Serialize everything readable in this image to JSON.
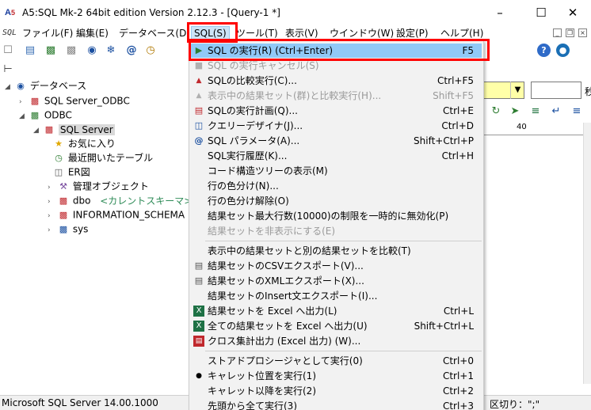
{
  "window": {
    "title": "A5:SQL Mk-2 64bit edition Version 2.12.3 - [Query-1 *]",
    "icon_text": "A5"
  },
  "menubar": {
    "sql_mark": "SQL",
    "items": [
      "ファイル(F)",
      "編集(E)",
      "データベース(D",
      "SQL(S)",
      "ツール(T)",
      "表示(V)",
      "ウインドウ(W)",
      "設定(P)",
      "ヘルプ(H)"
    ]
  },
  "tree": {
    "root": "データベース",
    "nodes": [
      {
        "label": "SQL Server_ODBC"
      },
      {
        "label": "ODBC"
      },
      {
        "label": "SQL Server"
      },
      {
        "label": "お気に入り"
      },
      {
        "label": "最近開いたテーブル"
      },
      {
        "label": "ER図"
      },
      {
        "label": "管理オブジェクト"
      },
      {
        "label": "dbo",
        "extra": "<カレントスキーマ>"
      },
      {
        "label": "INFORMATION_SCHEMA"
      },
      {
        "label": "sys"
      }
    ]
  },
  "dropdown": {
    "items": [
      {
        "label": "SQL の実行(R)  (Ctrl+Enter)",
        "shortcut": "F5",
        "icon": "play-icon"
      },
      {
        "label": "SQL の実行キャンセル(S)",
        "shortcut": "",
        "icon": "cancel-icon"
      },
      {
        "label": "SQLの比較実行(C)...",
        "shortcut": "Ctrl+F5",
        "icon": "compare-icon"
      },
      {
        "label": "表示中の結果セット(群)と比較実行(H)...",
        "shortcut": "Shift+F5",
        "icon": "compare-result-icon"
      },
      {
        "label": "SQLの実行計画(Q)...",
        "shortcut": "Ctrl+E",
        "icon": "plan-icon"
      },
      {
        "label": "クエリーデザイナ(J)...",
        "shortcut": "Ctrl+D",
        "icon": "designer-icon"
      },
      {
        "label": "SQL パラメータ(A)...",
        "shortcut": "Shift+Ctrl+P",
        "icon": "at-icon"
      },
      {
        "label": "SQL実行履歴(K)...",
        "shortcut": "Ctrl+H",
        "icon": ""
      },
      {
        "label": "コード構造ツリーの表示(M)",
        "shortcut": "",
        "icon": ""
      },
      {
        "label": "行の色分け(N)...",
        "shortcut": "",
        "icon": ""
      },
      {
        "label": "行の色分け解除(O)",
        "shortcut": "",
        "icon": ""
      },
      {
        "label": "結果セット最大行数(10000)の制限を一時的に無効化(P)",
        "shortcut": "",
        "icon": ""
      },
      {
        "label": "結果セットを非表示にする(E)",
        "shortcut": "",
        "icon": ""
      },
      {
        "label": "表示中の結果セットと別の結果セットを比較(T)",
        "shortcut": "",
        "icon": ""
      },
      {
        "label": "結果セットのCSVエクスポート(V)...",
        "shortcut": "",
        "icon": "csv-export-icon"
      },
      {
        "label": "結果セットのXMLエクスポート(X)...",
        "shortcut": "",
        "icon": "xml-export-icon"
      },
      {
        "label": "結果セットのInsert文エクスポート(I)...",
        "shortcut": "",
        "icon": ""
      },
      {
        "label": "結果セットを Excel へ出力(L)",
        "shortcut": "Ctrl+L",
        "icon": "excel-icon"
      },
      {
        "label": "全ての結果セットを Excel へ出力(U)",
        "shortcut": "Shift+Ctrl+L",
        "icon": "excel-all-icon"
      },
      {
        "label": "クロス集計出力 (Excel 出力) (W)...",
        "shortcut": "",
        "icon": "crosstab-icon"
      },
      {
        "label": "ストアドプロシージャとして実行(0)",
        "shortcut": "Ctrl+0",
        "icon": ""
      },
      {
        "label": "キャレット位置を実行(1)",
        "shortcut": "Ctrl+1",
        "icon": "bullet-icon"
      },
      {
        "label": "キャレット以降を実行(2)",
        "shortcut": "Ctrl+2",
        "icon": ""
      },
      {
        "label": "先頭から全て実行(3)",
        "shortcut": "Ctrl+3",
        "icon": ""
      }
    ]
  },
  "editor": {
    "right_label": "秒",
    "ruler_number": "40"
  },
  "statusbar": {
    "left": "Microsoft SQL Server 14.00.1000",
    "right": "区切り：\";\""
  },
  "colors": {
    "highlight": "#91c9f7",
    "annotation": "#ff0000",
    "menu_bg": "#f2f2f2"
  }
}
